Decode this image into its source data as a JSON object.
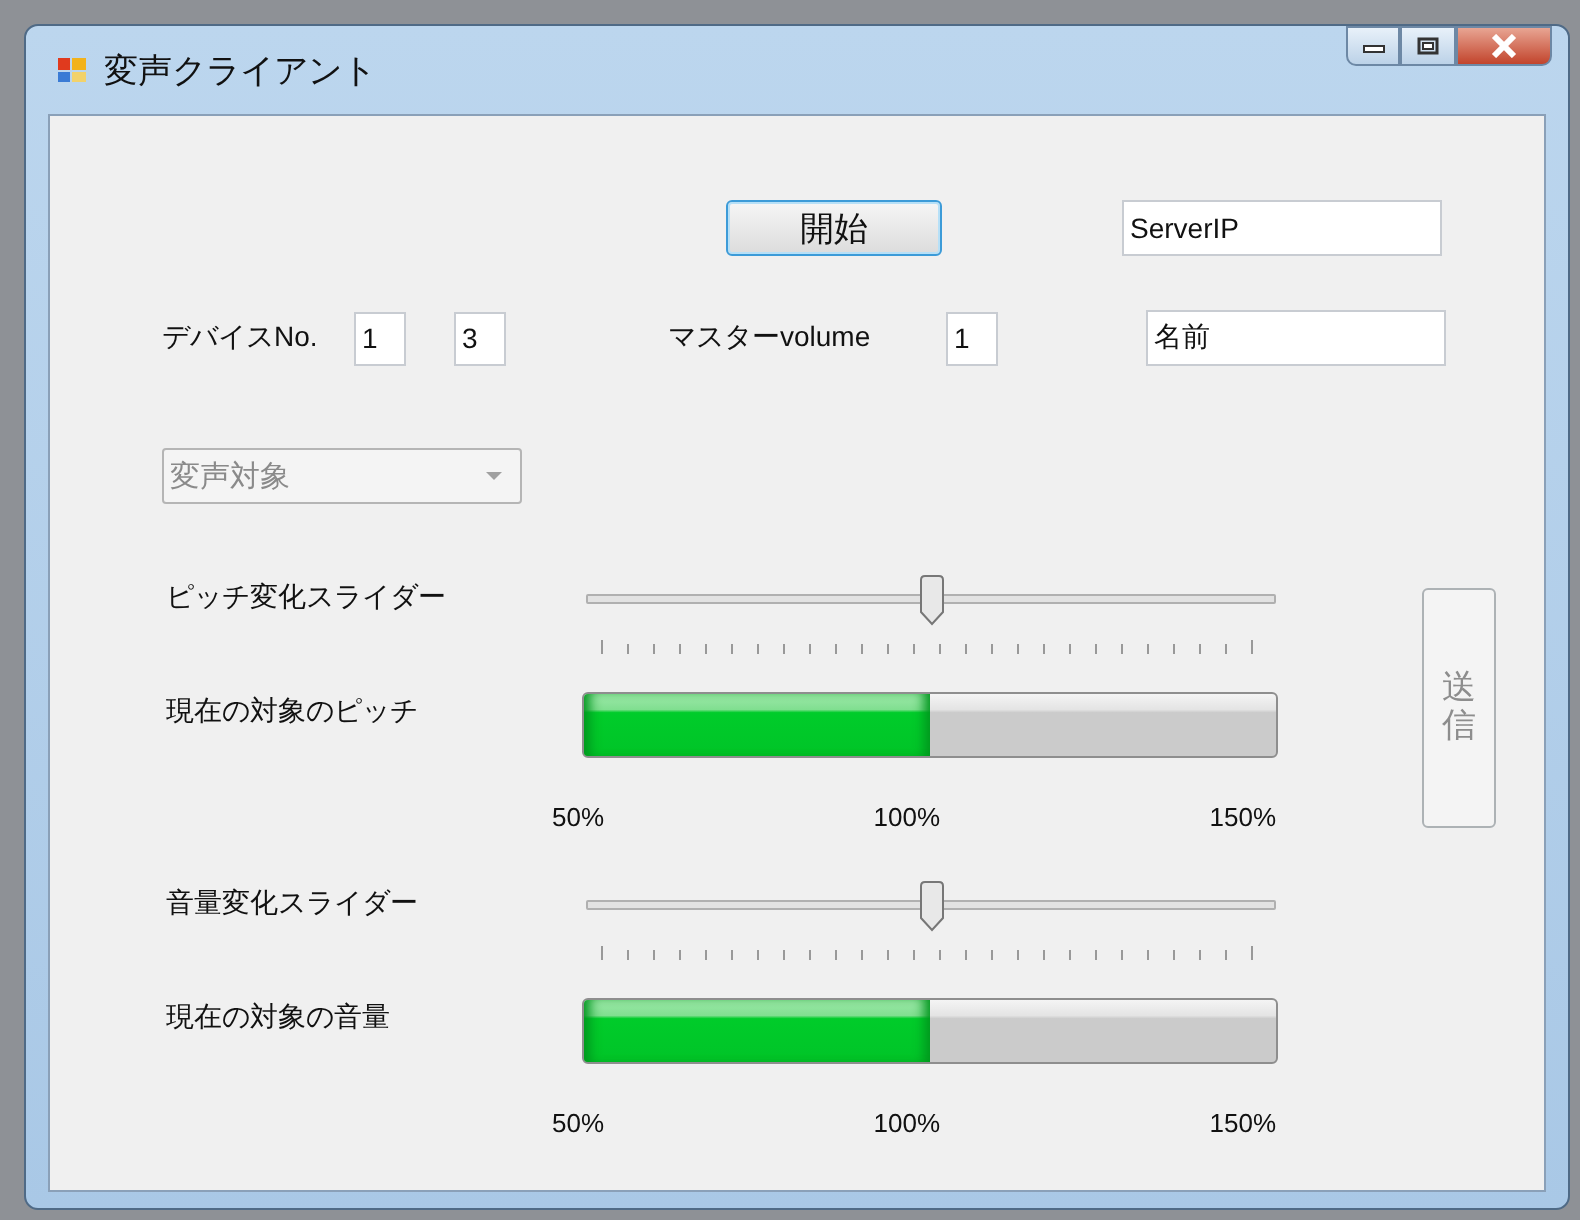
{
  "window": {
    "title": "変声クライアント"
  },
  "start_button": {
    "label": "開始"
  },
  "server_ip": {
    "value": "ServerIP"
  },
  "device": {
    "label": "デバイスNo.",
    "fields": [
      "1",
      "3"
    ]
  },
  "master_volume": {
    "label": "マスターvolume",
    "value": "1"
  },
  "name_field": {
    "value": "名前"
  },
  "target_combo": {
    "value": "変声対象",
    "disabled": true
  },
  "sections": [
    {
      "slider": {
        "label": "ピッチ変化スライダー",
        "level": 0.5
      },
      "meter": {
        "label": "現在の対象のピッチ",
        "level": 0.5
      },
      "scale": [
        "50%",
        "100%",
        "150%"
      ]
    },
    {
      "slider": {
        "label": "音量変化スライダー",
        "level": 0.5
      },
      "meter": {
        "label": "現在の対象の音量",
        "level": 0.5
      },
      "scale": [
        "50%",
        "100%",
        "150%"
      ]
    }
  ],
  "send_button": {
    "label": "送信",
    "disabled": true
  }
}
